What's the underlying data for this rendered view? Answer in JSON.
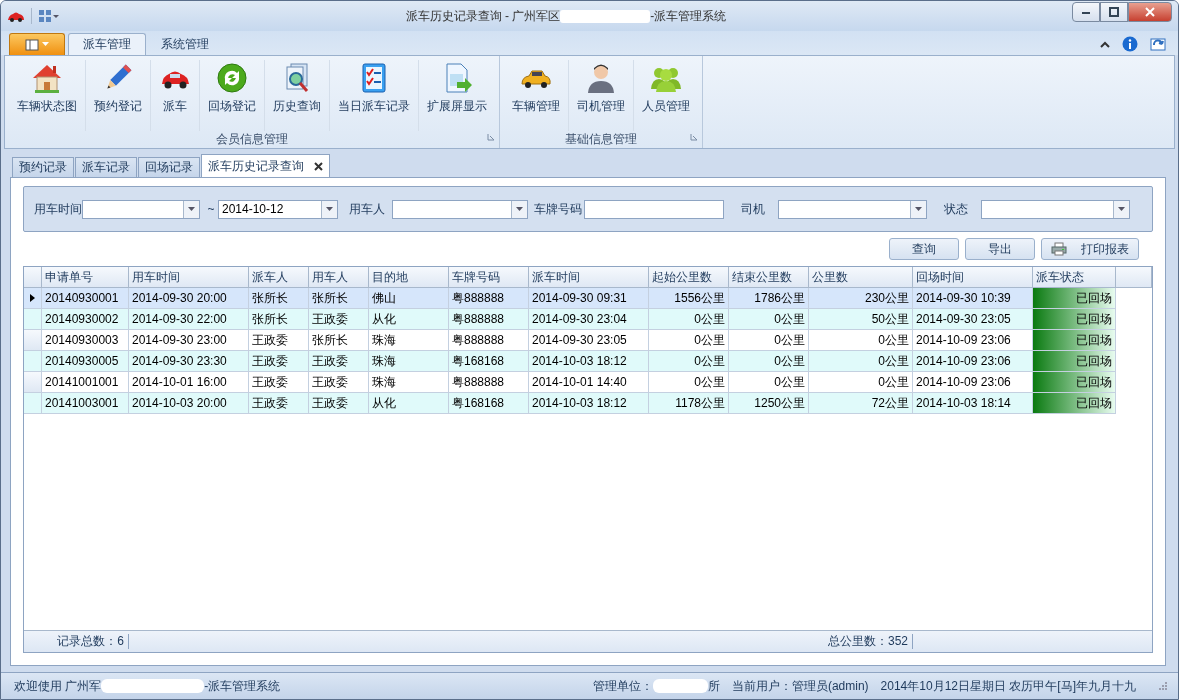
{
  "window": {
    "title_start": "派车历史记录查询 - 广州军区",
    "title_end": "-派车管理系统"
  },
  "ribbon": {
    "tabs": [
      {
        "label": "派车管理",
        "selected": true
      },
      {
        "label": "系统管理",
        "selected": false
      }
    ],
    "groups": [
      {
        "label": "会员信息管理",
        "items": [
          "车辆状态图",
          "预约登记",
          "派车",
          "回场登记",
          "历史查询",
          "当日派车记录",
          "扩展屏显示"
        ]
      },
      {
        "label": "基础信息管理",
        "items": [
          "车辆管理",
          "司机管理",
          "人员管理"
        ]
      }
    ]
  },
  "doc_tabs": [
    {
      "label": "预约记录",
      "selected": false,
      "closable": false
    },
    {
      "label": "派车记录",
      "selected": false,
      "closable": false
    },
    {
      "label": "回场记录",
      "selected": false,
      "closable": false
    },
    {
      "label": "派车历史记录查询",
      "selected": true,
      "closable": true
    }
  ],
  "filters": [
    {
      "label": "用车时间",
      "kind": "range",
      "separator": "~",
      "to_value": "2014-10-12"
    },
    {
      "label": "用车人",
      "kind": "combo"
    },
    {
      "label": "车牌号码",
      "kind": "text"
    },
    {
      "label": "司机",
      "kind": "combo"
    },
    {
      "label": "状态",
      "kind": "combo"
    }
  ],
  "actions": [
    {
      "label": "查询",
      "kind": "plain"
    },
    {
      "label": "导出",
      "kind": "plain"
    },
    {
      "label": "打印报表",
      "kind": "print"
    }
  ],
  "table": {
    "columns": [
      "申请单号",
      "用车时间",
      "派车人",
      "用车人",
      "目的地",
      "车牌号码",
      "派车时间",
      "起始公里数",
      "结束公里数",
      "公里数",
      "回场时间",
      "派车状态"
    ],
    "rows": [
      {
        "selected": true,
        "cells": [
          "20140930001",
          "2014-09-30 20:00",
          "张所长",
          "张所长",
          "佛山",
          "粤888888",
          "2014-09-30 09:31",
          "1556公里",
          "1786公里",
          "230公里",
          "2014-09-30 10:39",
          "已回场"
        ]
      },
      {
        "selected": false,
        "cells": [
          "20140930002",
          "2014-09-30 22:00",
          "张所长",
          "王政委",
          "从化",
          "粤888888",
          "2014-09-30 23:04",
          "0公里",
          "0公里",
          "50公里",
          "2014-09-30 23:05",
          "已回场"
        ]
      },
      {
        "selected": false,
        "cells": [
          "20140930003",
          "2014-09-30 23:00",
          "王政委",
          "张所长",
          "珠海",
          "粤888888",
          "2014-09-30 23:05",
          "0公里",
          "0公里",
          "0公里",
          "2014-10-09 23:06",
          "已回场"
        ]
      },
      {
        "selected": false,
        "cells": [
          "20140930005",
          "2014-09-30 23:30",
          "王政委",
          "王政委",
          "珠海",
          "粤168168",
          "2014-10-03 18:12",
          "0公里",
          "0公里",
          "0公里",
          "2014-10-09 23:06",
          "已回场"
        ]
      },
      {
        "selected": false,
        "cells": [
          "20141001001",
          "2014-10-01 16:00",
          "王政委",
          "王政委",
          "珠海",
          "粤888888",
          "2014-10-01 14:40",
          "0公里",
          "0公里",
          "0公里",
          "2014-10-09 23:06",
          "已回场"
        ]
      },
      {
        "selected": false,
        "cells": [
          "20141003001",
          "2014-10-03 20:00",
          "王政委",
          "王政委",
          "从化",
          "粤168168",
          "2014-10-03 18:12",
          "1178公里",
          "1250公里",
          "72公里",
          "2014-10-03 18:14",
          "已回场"
        ]
      }
    ],
    "summary": [
      "记录总数：6",
      "总公里数：352"
    ]
  },
  "status_bar": {
    "welcome_start": "欢迎使用 广州军",
    "welcome_end": "-派车管理系统",
    "unit_label": "管理单位：",
    "unit_end": "所",
    "user": "当前用户：管理员(admin)",
    "date": "2014年10月12日星期日 农历甲午[马]年九月十九"
  }
}
